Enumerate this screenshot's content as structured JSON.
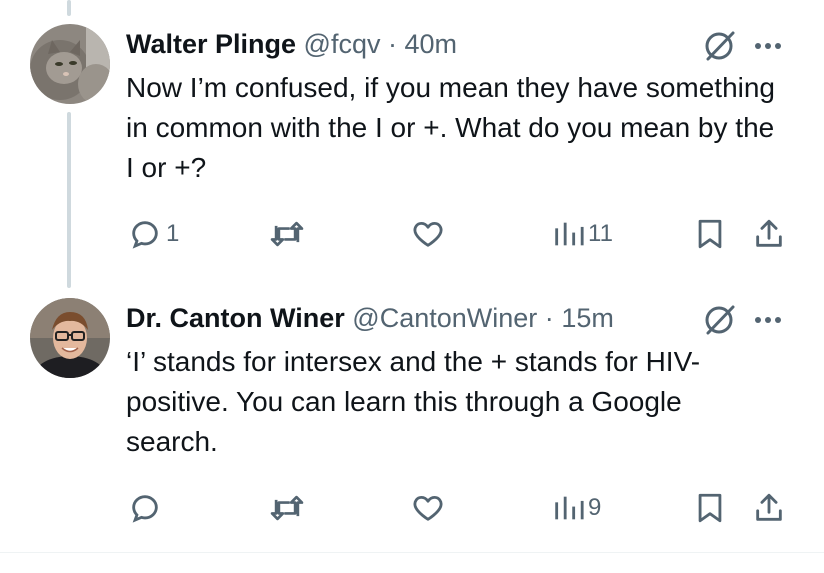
{
  "tweets": [
    {
      "name": "Walter Plinge",
      "handle": "@fcqv",
      "separator": "·",
      "time": "40m",
      "text": "Now I’m confused, if you mean they have something in common with the I or +. What do you mean by the I or +?",
      "replies": "1",
      "retweets": "",
      "likes": "",
      "views": "11"
    },
    {
      "name": "Dr. Canton Winer",
      "handle": "@CantonWiner",
      "separator": "·",
      "time": "15m",
      "text": "‘I’ stands for intersex and the + stands for HIV-positive. You can learn this through a Google search.",
      "replies": "",
      "retweets": "",
      "likes": "",
      "views": "9"
    }
  ],
  "colors": {
    "text": "#0f1419",
    "muted": "#536471",
    "thread_line": "#cfd9de"
  },
  "icons": [
    "grok-icon",
    "more-icon",
    "reply-icon",
    "retweet-icon",
    "like-icon",
    "views-icon",
    "bookmark-icon",
    "share-icon"
  ]
}
